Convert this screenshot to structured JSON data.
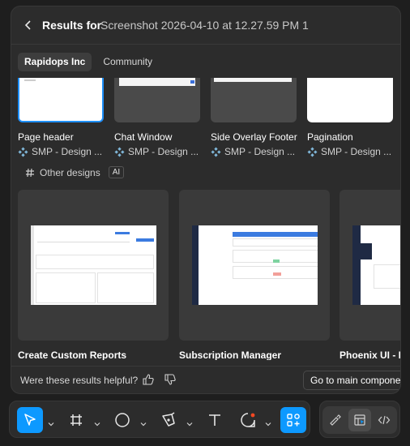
{
  "header": {
    "title": "Results for",
    "file": "Screenshot 2026-04-10 at 12.27.59 PM 1"
  },
  "tabs": [
    {
      "label": "Rapidops Inc",
      "active": true
    },
    {
      "label": "Community",
      "active": false
    }
  ],
  "top_cards": [
    {
      "name": "Page header",
      "library": "SMP - Design ...",
      "selected": true
    },
    {
      "name": "Chat Window",
      "library": "SMP - Design ..."
    },
    {
      "name": "Side Overlay Footer",
      "library": "SMP - Design ..."
    },
    {
      "name": "Pagination",
      "library": "SMP - Design ..."
    }
  ],
  "section": {
    "label": "Other designs",
    "badge": "AI"
  },
  "design_cards": [
    {
      "name": "Create Custom Reports"
    },
    {
      "name": "Subscription Manager"
    },
    {
      "name": "Phoenix UI - Ba"
    }
  ],
  "footer": {
    "question": "Were these results helpful?",
    "main_button": "Go to main componer"
  },
  "toolbar": {
    "tools": [
      "move-tool",
      "frame-tool",
      "shape-tool",
      "pen-tool",
      "text-tool",
      "comment-tool",
      "actions-tool"
    ],
    "accent": "#0d99ff"
  },
  "modes": [
    "draw-mode",
    "design-mode",
    "dev-mode"
  ]
}
